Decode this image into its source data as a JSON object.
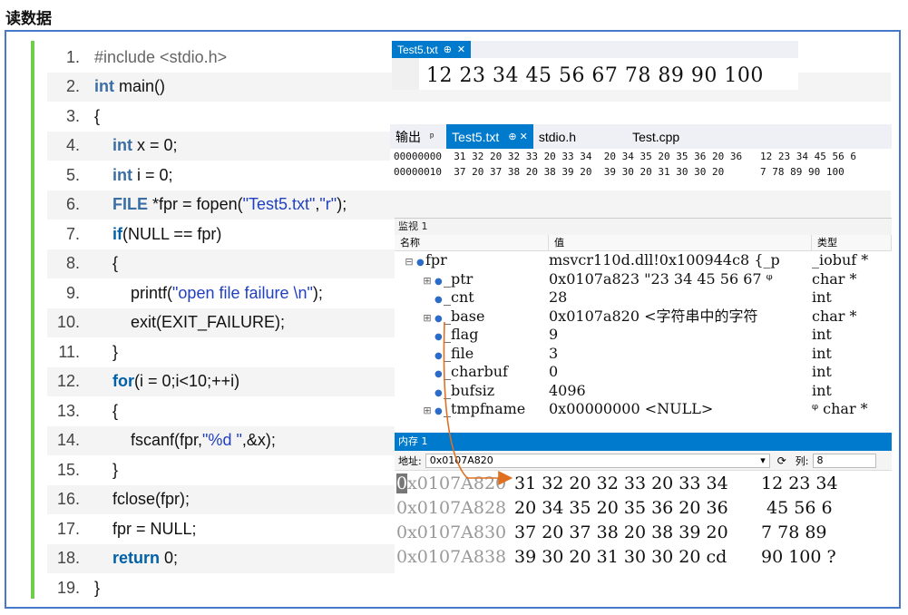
{
  "title": "读数据",
  "code": [
    {
      "n": "1.",
      "parts": [
        {
          "t": "#include <stdio.h>",
          "c": "pp"
        }
      ]
    },
    {
      "n": "2.",
      "parts": [
        {
          "t": "int",
          "c": "kt"
        },
        {
          "t": " main()",
          "c": ""
        }
      ]
    },
    {
      "n": "3.",
      "parts": [
        {
          "t": "{",
          "c": ""
        }
      ]
    },
    {
      "n": "4.",
      "parts": [
        {
          "t": "    ",
          "c": ""
        },
        {
          "t": "int",
          "c": "kt"
        },
        {
          "t": " x = 0;",
          "c": ""
        }
      ]
    },
    {
      "n": "5.",
      "parts": [
        {
          "t": "    ",
          "c": ""
        },
        {
          "t": "int",
          "c": "kt"
        },
        {
          "t": " i = 0;",
          "c": ""
        }
      ]
    },
    {
      "n": "6.",
      "parts": [
        {
          "t": "    ",
          "c": ""
        },
        {
          "t": "FILE",
          "c": "kt"
        },
        {
          "t": " *fpr = fopen(",
          "c": ""
        },
        {
          "t": "\"Test5.txt\"",
          "c": "str"
        },
        {
          "t": ",",
          "c": ""
        },
        {
          "t": "\"r\"",
          "c": "str"
        },
        {
          "t": ");",
          "c": ""
        }
      ]
    },
    {
      "n": "7.",
      "parts": [
        {
          "t": "    ",
          "c": ""
        },
        {
          "t": "if",
          "c": "kw"
        },
        {
          "t": "(NULL == fpr)",
          "c": ""
        }
      ]
    },
    {
      "n": "8.",
      "parts": [
        {
          "t": "    {",
          "c": ""
        }
      ]
    },
    {
      "n": "9.",
      "parts": [
        {
          "t": "        printf(",
          "c": ""
        },
        {
          "t": "\"open file failure \\n\"",
          "c": "str"
        },
        {
          "t": ");",
          "c": ""
        }
      ]
    },
    {
      "n": "10.",
      "parts": [
        {
          "t": "        exit(EXIT_FAILURE);",
          "c": ""
        }
      ]
    },
    {
      "n": "11.",
      "parts": [
        {
          "t": "    }",
          "c": ""
        }
      ]
    },
    {
      "n": "12.",
      "parts": [
        {
          "t": "    ",
          "c": ""
        },
        {
          "t": "for",
          "c": "kw"
        },
        {
          "t": "(i = 0;i<10;++i)",
          "c": ""
        }
      ]
    },
    {
      "n": "13.",
      "parts": [
        {
          "t": "    {",
          "c": ""
        }
      ]
    },
    {
      "n": "14.",
      "parts": [
        {
          "t": "        fscanf(fpr,",
          "c": ""
        },
        {
          "t": "\"%d \"",
          "c": "str"
        },
        {
          "t": ",&x);",
          "c": ""
        }
      ]
    },
    {
      "n": "15.",
      "parts": [
        {
          "t": "    }",
          "c": ""
        }
      ]
    },
    {
      "n": "16.",
      "parts": [
        {
          "t": "    fclose(fpr);",
          "c": ""
        }
      ]
    },
    {
      "n": "17.",
      "parts": [
        {
          "t": "    fpr = NULL;",
          "c": ""
        }
      ]
    },
    {
      "n": "18.",
      "parts": [
        {
          "t": "    ",
          "c": ""
        },
        {
          "t": "return",
          "c": "kw"
        },
        {
          "t": " 0;",
          "c": ""
        }
      ]
    },
    {
      "n": "19.",
      "parts": [
        {
          "t": "}",
          "c": ""
        }
      ]
    }
  ],
  "topview": {
    "tab_label": "Test5.txt",
    "pin": "⊕",
    "close": "✕",
    "content": "12 23 34 45 56 67 78 89 90 100"
  },
  "hexpanel": {
    "tabs": [
      {
        "label": "输出",
        "extra": "ᵖ",
        "active": false
      },
      {
        "label": "Test5.txt",
        "extra": "⊕ ✕",
        "active": true
      },
      {
        "label": "stdio.h",
        "extra": "",
        "active": false
      },
      {
        "label": "Test.cpp",
        "extra": "",
        "active": false
      }
    ],
    "rows": [
      "00000000  31 32 20 32 33 20 33 34  20 34 35 20 35 36 20 36   12 23 34 45 56 6",
      "00000010  37 20 37 38 20 38 39 20  39 30 20 31 30 30 20      7 78 89 90 100"
    ]
  },
  "watch": {
    "title": "监视 1",
    "headers": [
      "名称",
      "值",
      "类型"
    ],
    "rows": [
      {
        "exp": "⊟",
        "name": "fpr",
        "value": "msvcr110d.dll!0x100944c8 {_p",
        "type": "_iobuf *"
      },
      {
        "exp": "⊞",
        "name": "_ptr",
        "value": "0x0107a823 \"23 34 45 56 67 ᵠ",
        "type": "char *"
      },
      {
        "exp": "",
        "name": "_cnt",
        "value": "28",
        "type": "int"
      },
      {
        "exp": "⊞",
        "name": "_base",
        "value": "0x0107a820  <字符串中的字符",
        "type": "char *"
      },
      {
        "exp": "",
        "name": "_flag",
        "value": "9",
        "type": "int"
      },
      {
        "exp": "",
        "name": "_file",
        "value": "3",
        "type": "int"
      },
      {
        "exp": "",
        "name": "_charbuf",
        "value": "0",
        "type": "int"
      },
      {
        "exp": "",
        "name": "_bufsiz",
        "value": "4096",
        "type": "int"
      },
      {
        "exp": "⊞",
        "name": "_tmpfname",
        "value": "0x00000000 <NULL>",
        "type": "ᵠ char *"
      }
    ]
  },
  "memory": {
    "title": "内存 1",
    "addr_label": "地址:",
    "addr_value": "0x0107A820",
    "col_label": "列:",
    "col_value": "8",
    "rows": [
      {
        "first": "0",
        "addr": "x0107A820",
        "bytes": "31 32 20 32 33 20 33 34",
        "text": "12 23 34"
      },
      {
        "first": "",
        "addr": "0x0107A828",
        "bytes": "20 34 35 20 35 36 20 36",
        "text": " 45 56 6"
      },
      {
        "first": "",
        "addr": "0x0107A830",
        "bytes": "37 20 37 38 20 38 39 20",
        "text": "7 78 89"
      },
      {
        "first": "",
        "addr": "0x0107A838",
        "bytes": "39 30 20 31 30 30 20 cd",
        "text": "90 100 ?"
      }
    ]
  },
  "colors": {
    "accent": "#007acc",
    "frame": "#4a78c8",
    "gutter": "#6fcf4a",
    "arrow": "#e07020"
  }
}
